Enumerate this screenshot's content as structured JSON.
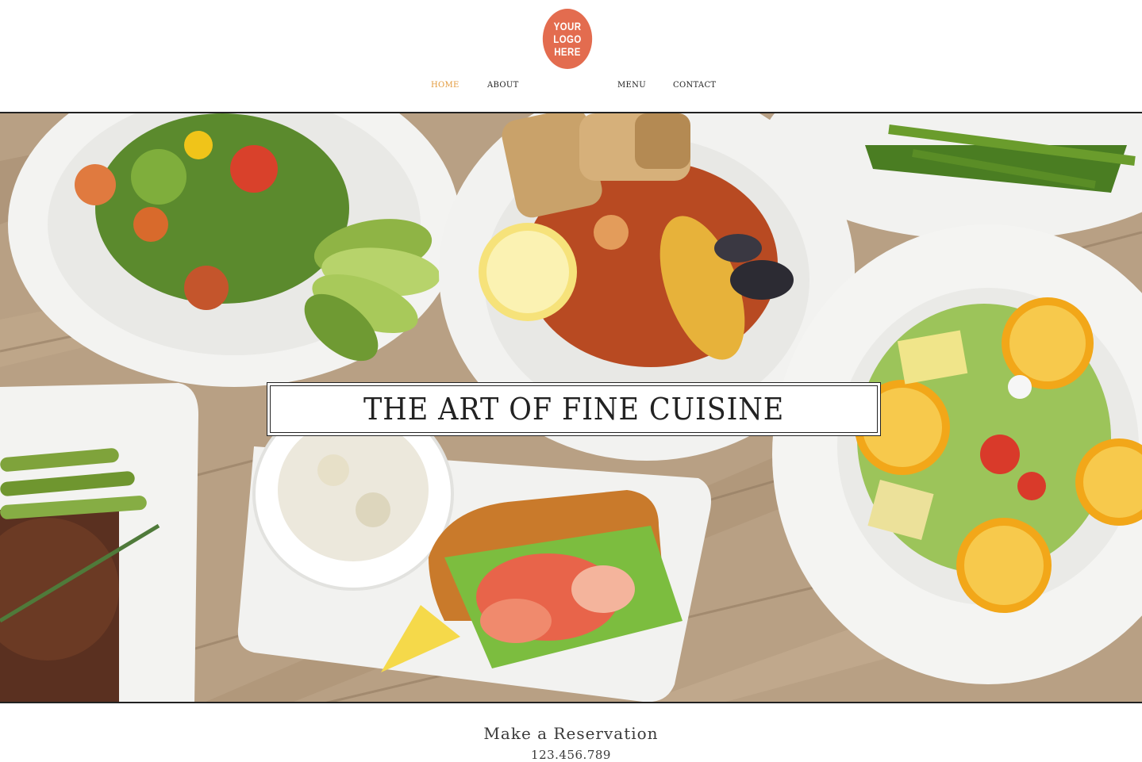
{
  "logo": {
    "lines": [
      "YOUR",
      "LOGO",
      "HERE"
    ]
  },
  "nav": {
    "items": [
      {
        "label": "HOME",
        "active": true
      },
      {
        "label": "ABOUT",
        "active": false
      },
      {
        "label": "MENU",
        "active": false
      },
      {
        "label": "CONTACT",
        "active": false
      }
    ]
  },
  "hero": {
    "tagline": "THE ART OF FINE CUISINE",
    "image_description": "overhead food photo"
  },
  "footer": {
    "reservation_label": "Make a Reservation",
    "phone": "123.456.789"
  },
  "colors": {
    "logo": "#e36c4f",
    "nav_active": "#e39a3c",
    "text": "#222222"
  }
}
